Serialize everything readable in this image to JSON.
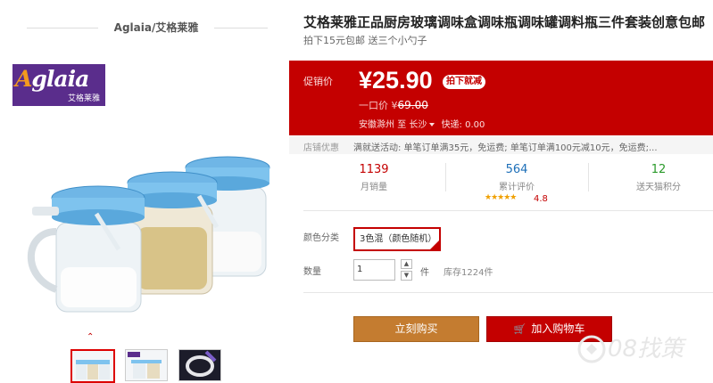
{
  "brand": {
    "title": "Aglaia/艾格莱雅",
    "logo_text": "Aglaia",
    "logo_cn": "艾格莱雅"
  },
  "gallery": {
    "up_arrow": "⌃",
    "thumbnails": [
      "thumb-1",
      "thumb-2",
      "thumb-3"
    ]
  },
  "product": {
    "title": "艾格莱雅正品厨房玻璃调味盒调味瓶调味罐调料瓶三件套装创意包邮",
    "subtitle": "拍下15元包邮 送三个小勺子"
  },
  "price": {
    "promo_label": "促销价",
    "currency": "¥",
    "value": "25.90",
    "badge": "拍下就减",
    "orig_label": "一口价 ¥",
    "orig_value": "69.00"
  },
  "shipping": {
    "from": "安徽滁州",
    "to_label": "至",
    "to": "长沙",
    "express": "快递: 0.00"
  },
  "coupon": {
    "label": "店铺优惠",
    "text": "满就送活动: 单笔订单满35元，免运费; 单笔订单满100元减10元，免运费;..."
  },
  "stats": [
    {
      "value": "1139",
      "label": "月销量"
    },
    {
      "value": "564",
      "label": "累计评价"
    },
    {
      "value": "12",
      "label": "送天猫积分"
    }
  ],
  "rating": {
    "stars": "★★★★★",
    "score": "4.8"
  },
  "options": {
    "color_label": "颜色分类",
    "color_value": "3色混（颜色随机）",
    "qty_label": "数量",
    "qty_value": "1",
    "qty_up": "▲",
    "qty_down": "▼",
    "unit": "件",
    "stock": "库存1224件"
  },
  "actions": {
    "buy": "立刻购买",
    "cart": "加入购物车",
    "cart_icon": "🛒"
  },
  "watermark": "08找策",
  "colors": {
    "accent": "#c40000",
    "buy_button": "#c47c30",
    "logo_bg": "#5a2d8c"
  }
}
